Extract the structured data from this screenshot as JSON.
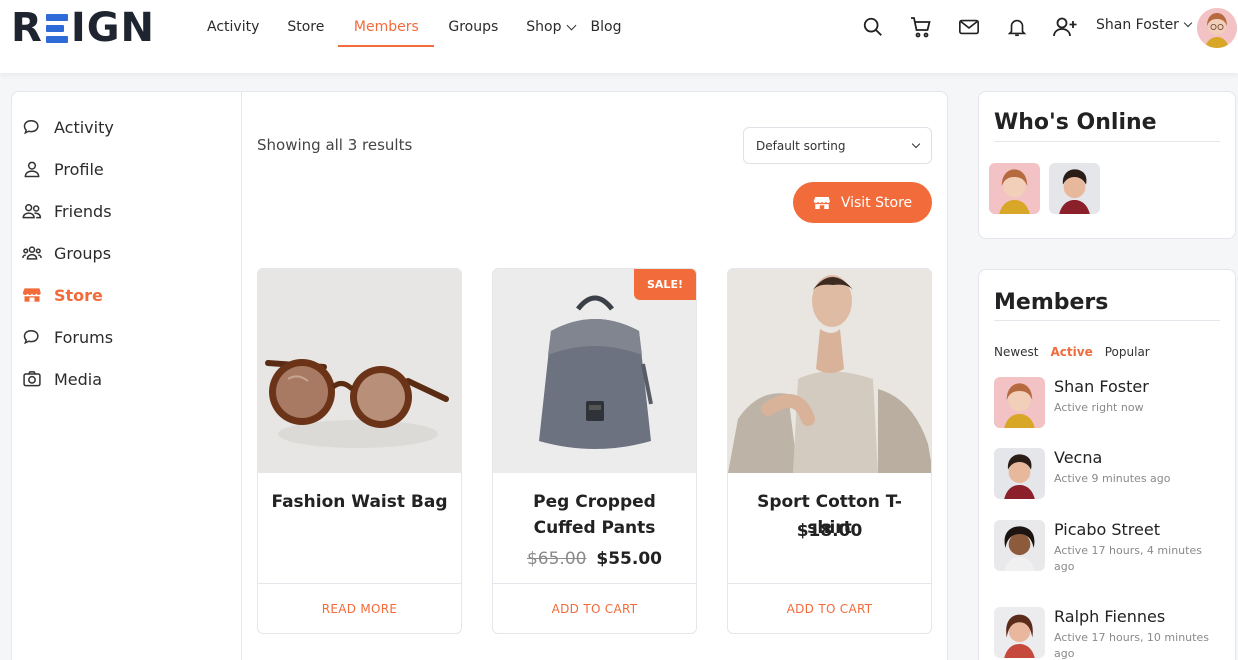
{
  "header": {
    "logo": "REIGN",
    "nav": [
      {
        "label": "Activity"
      },
      {
        "label": "Store"
      },
      {
        "label": "Members"
      },
      {
        "label": "Groups"
      },
      {
        "label": "Shop"
      },
      {
        "label": "Blog"
      }
    ],
    "active_nav": "Members",
    "icons": [
      "search-icon",
      "cart-icon",
      "mail-icon",
      "bell-icon",
      "add-friend-icon"
    ],
    "user_name": "Shan Foster"
  },
  "sidebar": {
    "items": [
      {
        "label": "Activity",
        "icon": "chat-bubbles-icon"
      },
      {
        "label": "Profile",
        "icon": "user-icon"
      },
      {
        "label": "Friends",
        "icon": "friends-icon"
      },
      {
        "label": "Groups",
        "icon": "groups-icon"
      },
      {
        "label": "Store",
        "icon": "store-icon"
      },
      {
        "label": "Forums",
        "icon": "forums-icon"
      },
      {
        "label": "Media",
        "icon": "camera-icon"
      }
    ],
    "active": "Store"
  },
  "shop": {
    "results_text": "Showing all 3 results",
    "sort_value": "Default sorting",
    "visit_store_label": "Visit Store",
    "products": [
      {
        "title": "Fashion Waist Bag",
        "price": "",
        "old_price": "",
        "sale": "",
        "action": "READ MORE"
      },
      {
        "title": "Peg Cropped Cuffed Pants",
        "price": "$55.00",
        "old_price": "$65.00",
        "sale": "SALE!",
        "action": "ADD TO CART"
      },
      {
        "title": "Sport Cotton T-shirt",
        "price": "$18.00",
        "old_price": "",
        "sale": "",
        "action": "ADD TO CART"
      }
    ]
  },
  "whos_online": {
    "title": "Who's Online"
  },
  "members": {
    "title": "Members",
    "tabs": [
      "Newest",
      "Active",
      "Popular"
    ],
    "active_tab": "Active",
    "list": [
      {
        "name": "Shan Foster",
        "status": "Active right now"
      },
      {
        "name": "Vecna",
        "status": "Active 9 minutes ago"
      },
      {
        "name": "Picabo Street",
        "status": "Active 17 hours, 4 minutes ago"
      },
      {
        "name": "Ralph Fiennes",
        "status": "Active 17 hours, 10 minutes ago"
      }
    ]
  },
  "colors": {
    "accent": "#f26b3a",
    "logo_blue": "#2f6bd8",
    "text": "#2b2b2b"
  }
}
